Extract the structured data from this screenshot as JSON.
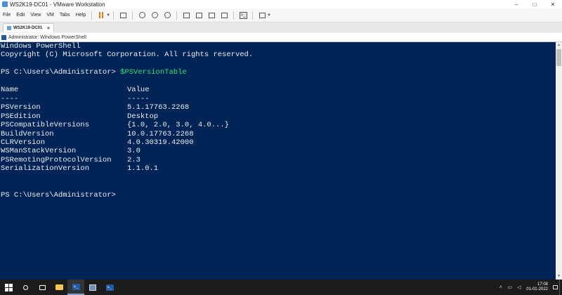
{
  "vmware": {
    "title": "WS2K19-DC01 - VMware Workstation",
    "menu": [
      "File",
      "Edit",
      "View",
      "VM",
      "Tabs",
      "Help"
    ],
    "tab_label": "WS2K19-DC01",
    "window_controls": {
      "minimize": "–",
      "maximize": "□",
      "close": "✕"
    }
  },
  "guest_window": {
    "title": "Administrator: Windows PowerShell"
  },
  "console": {
    "header_line_1": "Windows PowerShell",
    "header_line_2": "Copyright (C) Microsoft Corporation. All rights reserved.",
    "prompt_1": "PS C:\\Users\\Administrator> ",
    "command_1": "$PSVersionTable",
    "col_name": "Name",
    "col_value": "Value",
    "sep_name": "----",
    "sep_value": "-----",
    "rows": [
      {
        "name": "PSVersion",
        "value": "5.1.17763.2268"
      },
      {
        "name": "PSEdition",
        "value": "Desktop"
      },
      {
        "name": "PSCompatibleVersions",
        "value": "{1.0, 2.0, 3.0, 4.0...}"
      },
      {
        "name": "BuildVersion",
        "value": "10.0.17763.2268"
      },
      {
        "name": "CLRVersion",
        "value": "4.0.30319.42000"
      },
      {
        "name": "WSManStackVersion",
        "value": "3.0"
      },
      {
        "name": "PSRemotingProtocolVersion",
        "value": "2.3"
      },
      {
        "name": "SerializationVersion",
        "value": "1.1.0.1"
      }
    ],
    "prompt_2": "PS C:\\Users\\Administrator>"
  },
  "taskbar": {
    "clock_time": "17:08",
    "clock_date": "01-01-2022"
  },
  "colors": {
    "console_background": "#012456",
    "console_text": "#eeedf0",
    "command_highlight": "#3ae36f",
    "taskbar": "#1c1c1c"
  }
}
